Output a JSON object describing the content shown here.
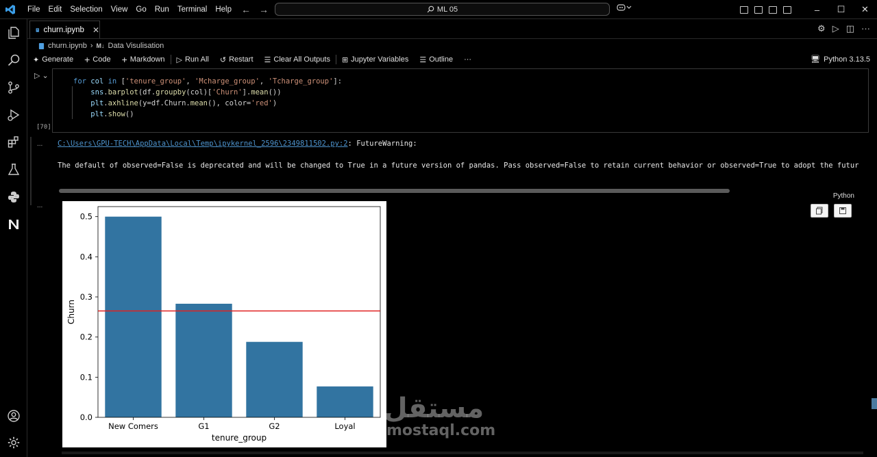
{
  "titlebar": {
    "menus": [
      "File",
      "Edit",
      "Selection",
      "View",
      "Go",
      "Run",
      "Terminal",
      "Help"
    ],
    "search_text": "ML 05",
    "controls": [
      "–",
      "☐",
      "✕"
    ]
  },
  "tab": {
    "label": "churn.ipynb"
  },
  "breadcrumb": {
    "file": "churn.ipynb",
    "section": "Data Visulisation",
    "section_badge": "M↓"
  },
  "toolbar": {
    "generate": "Generate",
    "code": "Code",
    "markdown": "Markdown",
    "run_all": "Run All",
    "restart": "Restart",
    "clear_outputs": "Clear All Outputs",
    "jupyter_variables": "Jupyter Variables",
    "outline": "Outline",
    "more": "···",
    "kernel": "Python 3.13.5"
  },
  "cell": {
    "exec_count": "[70]",
    "language": "Python",
    "code": {
      "l1_kw": "for",
      "l1_var": "col",
      "l1_in": "in",
      "l1_open": "[",
      "l1_s1": "'tenure_group'",
      "l1_c1": ", ",
      "l1_s2": "'Mcharge_group'",
      "l1_c2": ", ",
      "l1_s3": "'Tcharge_group'",
      "l1_close": "]:",
      "l2_a": "sns",
      "l2_fn": "barplot",
      "l2_b": "(df.",
      "l2_fn2": "groupby",
      "l2_c": "(col)[",
      "l2_s": "'Churn'",
      "l2_d": "].",
      "l2_fn3": "mean",
      "l2_e": "())",
      "l3_a": "plt",
      "l3_fn": "axhline",
      "l3_b": "(y=df.Churn.",
      "l3_fn2": "mean",
      "l3_c": "(), color=",
      "l3_s": "'red'",
      "l3_d": ")",
      "l4_a": "plt",
      "l4_fn": "show",
      "l4_b": "()"
    }
  },
  "output": {
    "gutter": "...",
    "warning_link": "C:\\Users\\GPU-TECH\\AppData\\Local\\Temp\\ipykernel_2596\\2349811502.py:2",
    "warning_label": ": FutureWarning:",
    "warning_message": "The default of observed=False is deprecated and will be changed to True in a future version of pandas. Pass observed=False to retain current behavior or observed=True to adopt the futur"
  },
  "chart_data": {
    "type": "bar",
    "categories": [
      "New Comers",
      "G1",
      "G2",
      "Loyal"
    ],
    "values": [
      0.5,
      0.283,
      0.188,
      0.077
    ],
    "xlabel": "tenure_group",
    "ylabel": "Churn",
    "ylim": [
      0,
      0.525
    ],
    "yticks": [
      "0.0",
      "0.1",
      "0.2",
      "0.3",
      "0.4",
      "0.5"
    ],
    "hline": 0.265,
    "bar_color": "#3274a1",
    "hline_color": "#e02020"
  },
  "watermark": {
    "arabic": "مستقل",
    "latin": "mostaql.com"
  }
}
